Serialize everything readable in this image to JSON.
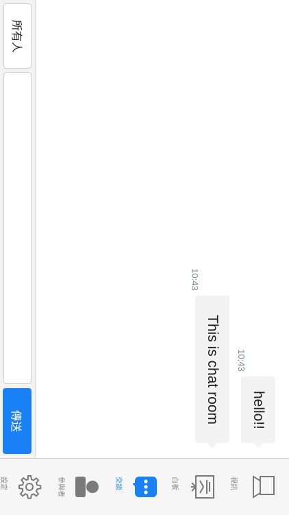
{
  "compose": {
    "recipient": "所有人",
    "input_value": "",
    "send_label": "傳送"
  },
  "messages": [
    {
      "text": "hello!!",
      "time": "10:43"
    },
    {
      "text": "This is chat room",
      "time": "10:43"
    }
  ],
  "tabs": [
    {
      "label": "設定",
      "icon": "gear-icon",
      "active": false
    },
    {
      "label": "參與者",
      "icon": "participant-icon",
      "active": false
    },
    {
      "label": "交談",
      "icon": "chat-icon",
      "active": true
    },
    {
      "label": "白板",
      "icon": "whiteboard-icon",
      "active": false
    },
    {
      "label": "視訊",
      "icon": "video-icon",
      "active": false
    }
  ],
  "colors": {
    "accent": "#1a80f6",
    "bubble": "#f3f3f3",
    "icon_gray": "#7a7a7a"
  }
}
